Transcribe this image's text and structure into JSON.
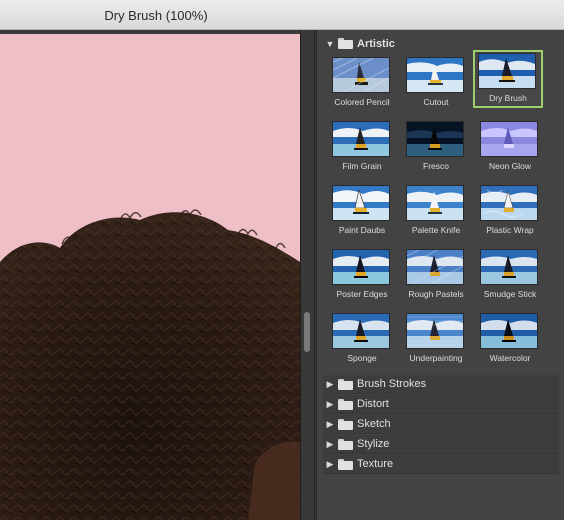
{
  "window": {
    "title": "Dry Brush (100%)"
  },
  "gallery": {
    "open_category": "Artistic",
    "selected_filter": "Dry Brush",
    "filters": [
      {
        "label": "Colored Pencil",
        "name": "filter-colored-pencil"
      },
      {
        "label": "Cutout",
        "name": "filter-cutout"
      },
      {
        "label": "Dry Brush",
        "name": "filter-dry-brush"
      },
      {
        "label": "Film Grain",
        "name": "filter-film-grain"
      },
      {
        "label": "Fresco",
        "name": "filter-fresco"
      },
      {
        "label": "Neon Glow",
        "name": "filter-neon-glow"
      },
      {
        "label": "Paint Daubs",
        "name": "filter-paint-daubs"
      },
      {
        "label": "Palette Knife",
        "name": "filter-palette-knife"
      },
      {
        "label": "Plastic Wrap",
        "name": "filter-plastic-wrap"
      },
      {
        "label": "Poster Edges",
        "name": "filter-poster-edges"
      },
      {
        "label": "Rough Pastels",
        "name": "filter-rough-pastels"
      },
      {
        "label": "Smudge Stick",
        "name": "filter-smudge-stick"
      },
      {
        "label": "Sponge",
        "name": "filter-sponge"
      },
      {
        "label": "Underpainting",
        "name": "filter-underpainting"
      },
      {
        "label": "Watercolor",
        "name": "filter-watercolor"
      }
    ],
    "categories": [
      {
        "label": "Artistic",
        "expanded": true
      },
      {
        "label": "Brush Strokes",
        "expanded": false
      },
      {
        "label": "Distort",
        "expanded": false
      },
      {
        "label": "Sketch",
        "expanded": false
      },
      {
        "label": "Stylize",
        "expanded": false
      },
      {
        "label": "Texture",
        "expanded": false
      }
    ]
  },
  "icons": {
    "expanded": "triangle-down-icon",
    "collapsed": "triangle-right-icon",
    "folder": "folder-icon"
  },
  "colors": {
    "selection": "#9ecf6a",
    "canvas_background": "#efbfc8",
    "panel": "#434343"
  }
}
